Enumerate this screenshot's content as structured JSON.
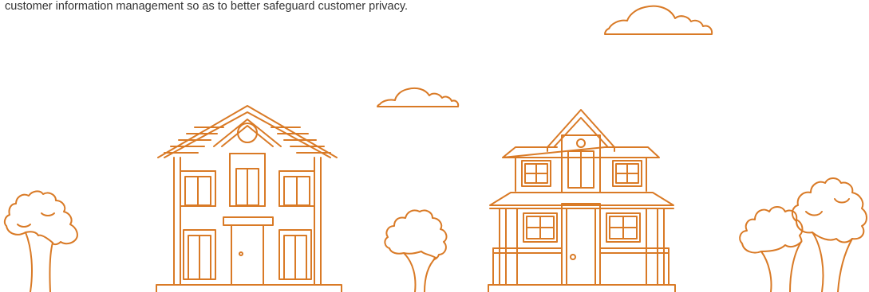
{
  "intro": {
    "text": "customer information management so as to better safeguard customer privacy."
  },
  "illustration": {
    "line_color": "#d97a26",
    "style": "orange line-art neighborhood",
    "elements": [
      "cloud-icon",
      "cloud-icon",
      "tree-icon",
      "tree-icon",
      "tree-icon",
      "tree-icon",
      "house-icon",
      "house-icon"
    ]
  }
}
